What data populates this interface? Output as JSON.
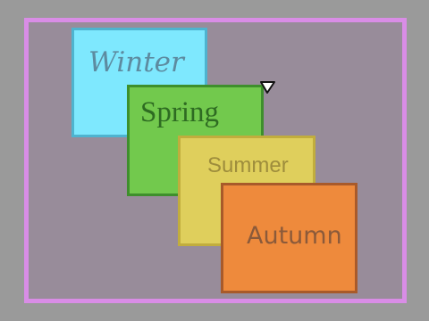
{
  "cards": [
    {
      "label": "Winter"
    },
    {
      "label": "Spring"
    },
    {
      "label": "Summer"
    },
    {
      "label": "Autumn"
    }
  ],
  "colors": {
    "background": "#9a9a9a",
    "board": "#988c9a",
    "board_border": "#d98de6",
    "winter": "#7ee8fe",
    "spring": "#72c94d",
    "summer": "#dfcf5c",
    "autumn": "#ee8a3c"
  },
  "cursor": {
    "icon": "pointer-triangle-icon"
  }
}
